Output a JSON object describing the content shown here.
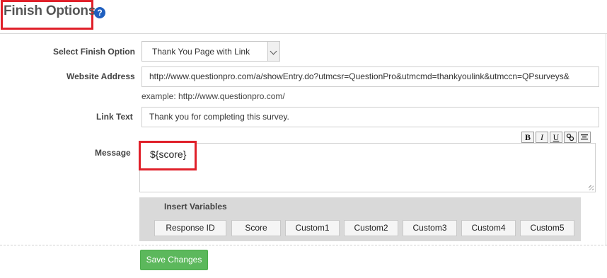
{
  "header": {
    "title": "Finish Options",
    "help_icon": "question-circle-icon",
    "help_glyph": "?"
  },
  "form": {
    "finish_option": {
      "label": "Select Finish Option",
      "value": "Thank You Page with Link"
    },
    "website_address": {
      "label": "Website Address",
      "value": "http://www.questionpro.com/a/showEntry.do?utmcsr=QuestionPro&utmcmd=thankyoulink&utmccn=QPsurveys&",
      "example": "example: http://www.questionpro.com/"
    },
    "link_text": {
      "label": "Link Text",
      "value": "Thank you for completing this survey."
    },
    "message": {
      "label": "Message",
      "value": "${score}",
      "toolbar": [
        {
          "name": "bold-icon",
          "glyph": "B"
        },
        {
          "name": "italic-icon",
          "glyph": "I"
        },
        {
          "name": "underline-icon",
          "glyph": "U"
        },
        {
          "name": "link-icon",
          "glyph": "🔗"
        },
        {
          "name": "align-center-icon",
          "glyph": "≡"
        }
      ]
    }
  },
  "insert_variables": {
    "title": "Insert Variables",
    "buttons": [
      "Response ID",
      "Score",
      "Custom1",
      "Custom2",
      "Custom3",
      "Custom4",
      "Custom5"
    ]
  },
  "actions": {
    "save_label": "Save Changes"
  },
  "colors": {
    "highlight_border": "#e0202a",
    "save_button": "#5cb85c",
    "help_icon": "#1f5fbf",
    "variables_panel": "#d9d9d9"
  }
}
